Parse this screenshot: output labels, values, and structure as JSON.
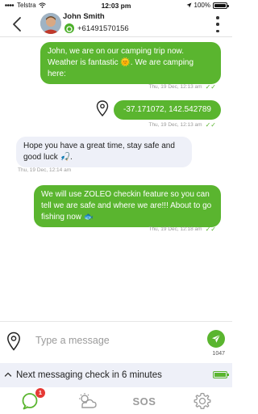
{
  "status_bar": {
    "carrier": "Telstra",
    "time": "12:03 pm",
    "battery": "100%",
    "battery_level": 1.0
  },
  "header": {
    "contact_name": "John Smith",
    "contact_phone": "+61491570156"
  },
  "messages": [
    {
      "direction": "outgoing",
      "text": "John, we are on our camping trip now. Weather is fantastic 🌞. We are camping here:",
      "timestamp": "Thu, 19 Dec, 12:13 am",
      "status_icon": "double-check-icon"
    },
    {
      "direction": "outgoing",
      "type": "location",
      "text": "-37.171072, 142.542789",
      "timestamp": "Thu, 19 Dec, 12:13 am",
      "status_icon": "double-check-icon"
    },
    {
      "direction": "incoming",
      "text": "Hope you have a great time, stay safe and good luck 🎣.",
      "timestamp": "Thu, 19 Dec, 12:14 am"
    },
    {
      "direction": "outgoing",
      "text": "We will use ZOLEO checkin feature so you can tell we are safe and where we are!!! About to go fishing now 🐟",
      "timestamp": "Thu, 19 Dec, 12:18 am",
      "status_icon": "double-check-icon"
    }
  ],
  "composer": {
    "placeholder": "Type a message",
    "char_count": "1047"
  },
  "check_bar": {
    "text": "Next messaging check in 6 minutes",
    "device_battery_level": 1.0
  },
  "tabs": {
    "messages_badge": "1",
    "sos_label": "SOS"
  },
  "colors": {
    "accent": "#5ab52f",
    "incoming_bubble": "#eef0f8",
    "badge": "#e53935"
  }
}
